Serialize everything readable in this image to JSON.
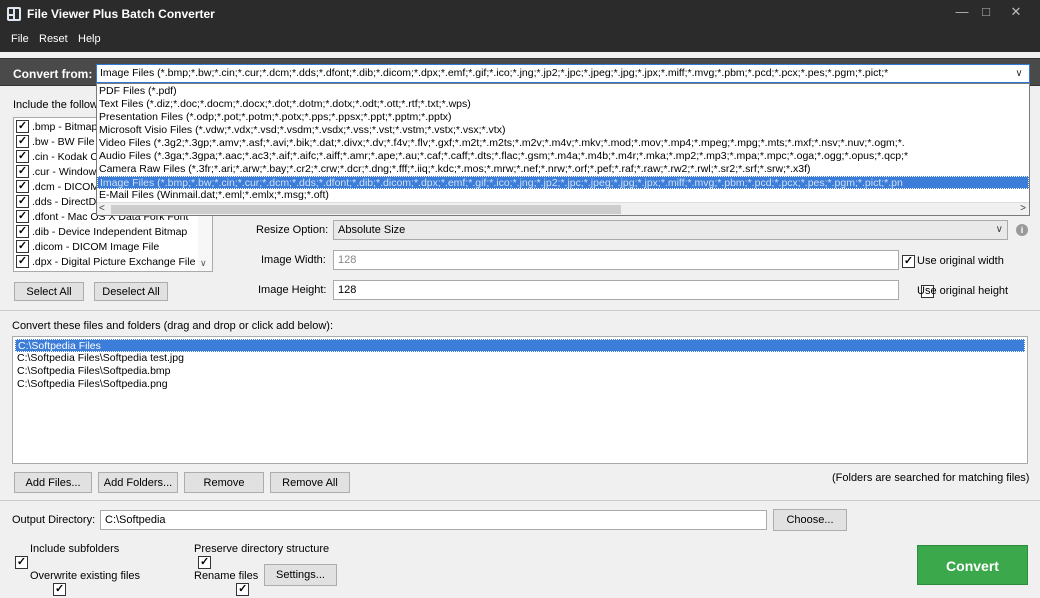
{
  "window": {
    "title": "File Viewer Plus Batch Converter"
  },
  "menu": {
    "items": [
      "File",
      "Reset",
      "Help"
    ]
  },
  "convert_from": {
    "label": "Convert from:",
    "selected": "Image Files (*.bmp;*.bw;*.cin;*.cur;*.dcm;*.dds;*.dfont;*.dib;*.dicom;*.dpx;*.emf;*.gif;*.ico;*.jng;*.jp2;*.jpc;*.jpeg;*.jpg;*.jpx;*.miff;*.mvg;*.pbm;*.pcd;*.pcx;*.pes;*.pgm;*.pict;*",
    "options": [
      "PDF Files (*.pdf)",
      "Text Files (*.diz;*.doc;*.docm;*.docx;*.dot;*.dotm;*.dotx;*.odt;*.ott;*.rtf;*.txt;*.wps)",
      "Presentation Files (*.odp;*.pot;*.potm;*.potx;*.pps;*.ppsx;*.ppt;*.pptm;*.pptx)",
      "Microsoft Visio Files (*.vdw;*.vdx;*.vsd;*.vsdm;*.vsdx;*.vss;*.vst;*.vstm;*.vstx;*.vsx;*.vtx)",
      "Video Files (*.3g2;*.3gp;*.amv;*.asf;*.avi;*.bik;*.dat;*.divx;*.dv;*.f4v;*.flv;*.gxf;*.m2t;*.m2ts;*.m2v;*.m4v;*.mkv;*.mod;*.mov;*.mp4;*.mpeg;*.mpg;*.mts;*.mxf;*.nsv;*.nuv;*.ogm;*.",
      "Audio Files (*.3ga;*.3gpa;*.aac;*.ac3;*.aif;*.aifc;*.aiff;*.amr;*.ape;*.au;*.caf;*.caff;*.dts;*.flac;*.gsm;*.m4a;*.m4b;*.m4r;*.mka;*.mp2;*.mp3;*.mpa;*.mpc;*.oga;*.ogg;*.opus;*.qcp;*",
      "Camera Raw Files (*.3fr;*.ari;*.arw;*.bay;*.cr2;*.crw;*.dcr;*.dng;*.fff;*.iiq;*.kdc;*.mos;*.mrw;*.nef;*.nrw;*.orf;*.pef;*.raf;*.raw;*.rw2;*.rwl;*.sr2;*.srf;*.srw;*.x3f)",
      "Image Files (*.bmp;*.bw;*.cin;*.cur;*.dcm;*.dds;*.dfont;*.dib;*.dicom;*.dpx;*.emf;*.gif;*.ico;*.jng;*.jp2;*.jpc;*.jpeg;*.jpg;*.jpx;*.miff;*.mvg;*.pbm;*.pcd;*.pcx;*.pes;*.pgm;*.pict;*.pn",
      "E-Mail Files (Winmail.dat;*.eml;*.emlx;*.msg;*.oft)"
    ]
  },
  "include": {
    "label": "Include the follow",
    "extensions": [
      ".bmp - Bitmap",
      ".bw - BW File",
      ".cin - Kodak C",
      ".cur - Window",
      ".dcm - DICOM",
      ".dds - DirectD",
      ".dfont - Mac OS X Data Fork Font",
      ".dib - Device Independent Bitmap",
      ".dicom - DICOM Image File",
      ".dpx - Digital Picture Exchange File"
    ],
    "select_all": "Select All",
    "deselect_all": "Deselect All"
  },
  "resize": {
    "option_label": "Resize Option:",
    "option_value": "Absolute Size",
    "width_label": "Image Width:",
    "width_value": "128",
    "use_original_width": "Use original width",
    "height_label": "Image Height:",
    "height_value": "128",
    "use_original_height": "Use original height"
  },
  "files": {
    "header": "Convert these files and folders (drag and drop or click add below):",
    "items": [
      "C:\\Softpedia Files",
      "C:\\Softpedia Files\\Softpedia test.jpg",
      "C:\\Softpedia Files\\Softpedia.bmp",
      "C:\\Softpedia Files\\Softpedia.png"
    ],
    "add_files": "Add Files...",
    "add_folders": "Add Folders...",
    "remove": "Remove",
    "remove_all": "Remove All",
    "note": "(Folders are searched for matching files)"
  },
  "output": {
    "label": "Output Directory:",
    "value": "C:\\Softpedia",
    "choose": "Choose..."
  },
  "options": {
    "include_subfolders": "Include subfolders",
    "preserve_structure": "Preserve directory structure",
    "overwrite": "Overwrite existing files",
    "rename": "Rename files",
    "settings": "Settings..."
  },
  "convert_button": "Convert",
  "colors": {
    "accent": "#3b7dd8",
    "convert": "#3aa84b",
    "titlebar": "#2b2b2b"
  }
}
